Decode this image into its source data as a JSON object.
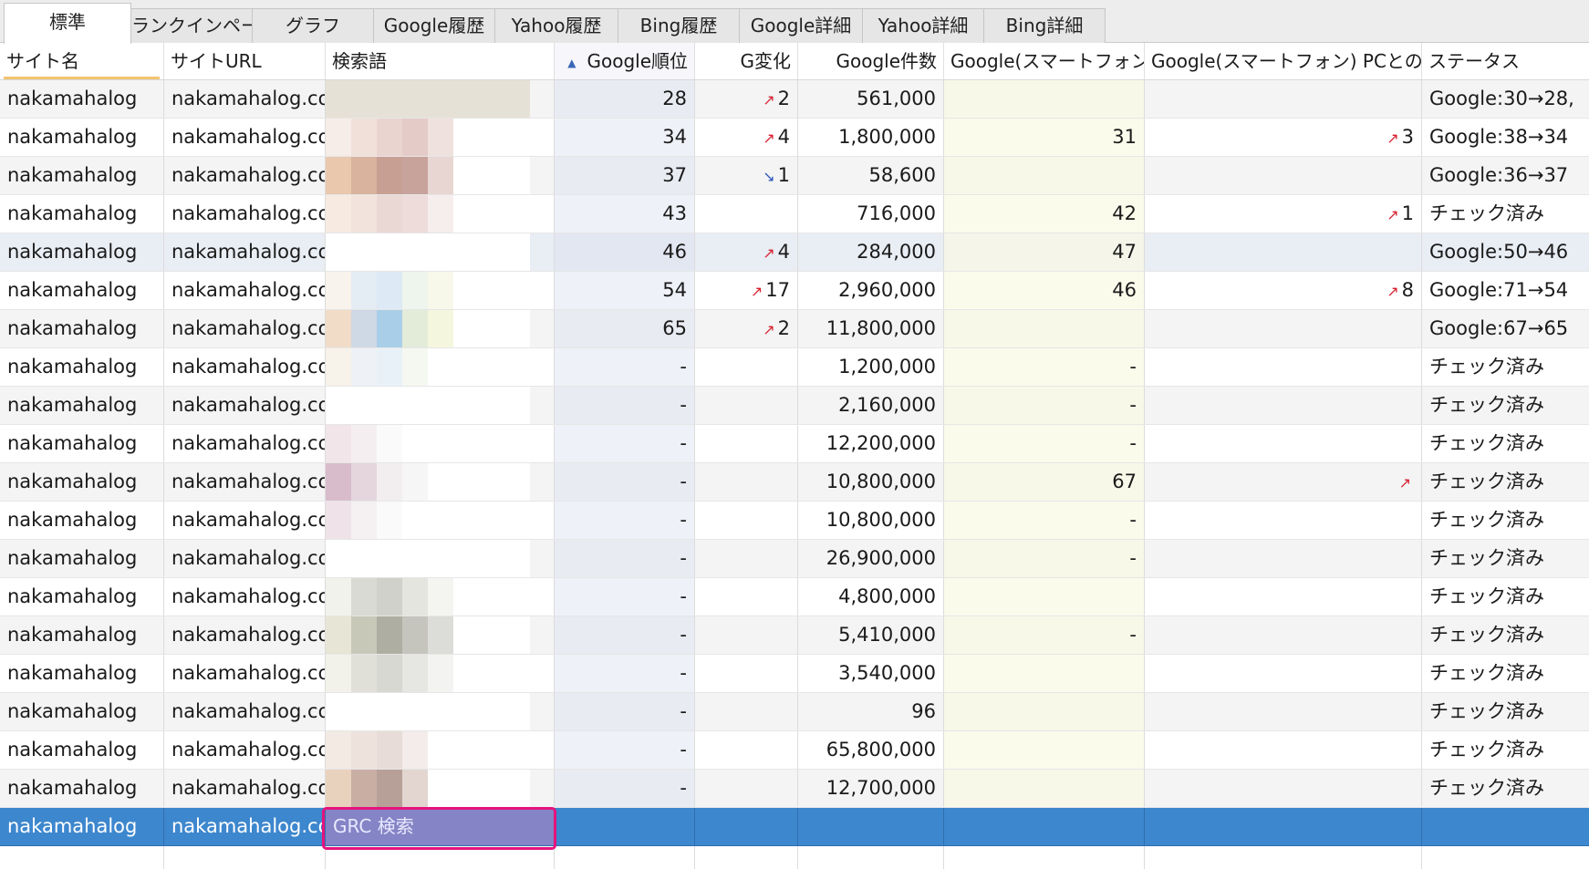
{
  "tabs": [
    "標準",
    "ランクインページ",
    "グラフ",
    "Google履歴",
    "Yahoo履歴",
    "Bing履歴",
    "Google詳細",
    "Yahoo詳細",
    "Bing詳細"
  ],
  "active_tab": 0,
  "columns": [
    "サイト名",
    "サイトURL",
    "検索語",
    "Google順位",
    "G変化",
    "Google件数",
    "Google(スマートフォン)",
    "Google(スマートフォン) PCとの差",
    "ステータス"
  ],
  "sorted_column": "Google順位",
  "sort_direction": "ascending",
  "colors": {
    "selection": "#3d87ce",
    "selected_keyword_bg": "#8484c6",
    "outline": "#e5137d",
    "arrow_up": "#d6202e",
    "arrow_down": "#2b56b8"
  },
  "rows": [
    {
      "site": "nakamahalog",
      "url": "nakamahalog.co",
      "keyword": "",
      "rank": "28",
      "change": "2",
      "change_dir": "up",
      "count": "561,000",
      "smart": "",
      "diff": "",
      "diff_dir": "",
      "status": "Google:30→28,"
    },
    {
      "site": "nakamahalog",
      "url": "nakamahalog.co",
      "keyword": "",
      "rank": "34",
      "change": "4",
      "change_dir": "up",
      "count": "1,800,000",
      "smart": "31",
      "diff": "3",
      "diff_dir": "up",
      "status": "Google:38→34"
    },
    {
      "site": "nakamahalog",
      "url": "nakamahalog.co",
      "keyword": "",
      "rank": "37",
      "change": "1",
      "change_dir": "down",
      "count": "58,600",
      "smart": "",
      "diff": "",
      "diff_dir": "",
      "status": "Google:36→37"
    },
    {
      "site": "nakamahalog",
      "url": "nakamahalog.co",
      "keyword": "",
      "rank": "43",
      "change": "",
      "change_dir": "",
      "count": "716,000",
      "smart": "42",
      "diff": "1",
      "diff_dir": "up",
      "status": "チェック済み"
    },
    {
      "site": "nakamahalog",
      "url": "nakamahalog.co",
      "keyword": "",
      "rank": "46",
      "change": "4",
      "change_dir": "up",
      "count": "284,000",
      "smart": "47",
      "diff": "",
      "diff_dir": "",
      "status": "Google:50→46"
    },
    {
      "site": "nakamahalog",
      "url": "nakamahalog.co",
      "keyword": "",
      "rank": "54",
      "change": "17",
      "change_dir": "up",
      "count": "2,960,000",
      "smart": "46",
      "diff": "8",
      "diff_dir": "up",
      "status": "Google:71→54"
    },
    {
      "site": "nakamahalog",
      "url": "nakamahalog.co",
      "keyword": "",
      "rank": "65",
      "change": "2",
      "change_dir": "up",
      "count": "11,800,000",
      "smart": "",
      "diff": "",
      "diff_dir": "",
      "status": "Google:67→65"
    },
    {
      "site": "nakamahalog",
      "url": "nakamahalog.co",
      "keyword": "",
      "rank": "-",
      "change": "",
      "change_dir": "",
      "count": "1,200,000",
      "smart": "-",
      "diff": "",
      "diff_dir": "",
      "status": "チェック済み"
    },
    {
      "site": "nakamahalog",
      "url": "nakamahalog.co",
      "keyword": "",
      "rank": "-",
      "change": "",
      "change_dir": "",
      "count": "2,160,000",
      "smart": "-",
      "diff": "",
      "diff_dir": "",
      "status": "チェック済み"
    },
    {
      "site": "nakamahalog",
      "url": "nakamahalog.co",
      "keyword": "",
      "rank": "-",
      "change": "",
      "change_dir": "",
      "count": "12,200,000",
      "smart": "-",
      "diff": "",
      "diff_dir": "",
      "status": "チェック済み"
    },
    {
      "site": "nakamahalog",
      "url": "nakamahalog.co",
      "keyword": "",
      "rank": "-",
      "change": "",
      "change_dir": "",
      "count": "10,800,000",
      "smart": "67",
      "diff": "",
      "diff_dir": "up",
      "status": "チェック済み"
    },
    {
      "site": "nakamahalog",
      "url": "nakamahalog.co",
      "keyword": "",
      "rank": "-",
      "change": "",
      "change_dir": "",
      "count": "10,800,000",
      "smart": "-",
      "diff": "",
      "diff_dir": "",
      "status": "チェック済み"
    },
    {
      "site": "nakamahalog",
      "url": "nakamahalog.co",
      "keyword": "",
      "rank": "-",
      "change": "",
      "change_dir": "",
      "count": "26,900,000",
      "smart": "-",
      "diff": "",
      "diff_dir": "",
      "status": "チェック済み"
    },
    {
      "site": "nakamahalog",
      "url": "nakamahalog.co",
      "keyword": "",
      "rank": "-",
      "change": "",
      "change_dir": "",
      "count": "4,800,000",
      "smart": "",
      "diff": "",
      "diff_dir": "",
      "status": "チェック済み"
    },
    {
      "site": "nakamahalog",
      "url": "nakamahalog.co",
      "keyword": "",
      "rank": "-",
      "change": "",
      "change_dir": "",
      "count": "5,410,000",
      "smart": "-",
      "diff": "",
      "diff_dir": "",
      "status": "チェック済み"
    },
    {
      "site": "nakamahalog",
      "url": "nakamahalog.co",
      "keyword": "",
      "rank": "-",
      "change": "",
      "change_dir": "",
      "count": "3,540,000",
      "smart": "",
      "diff": "",
      "diff_dir": "",
      "status": "チェック済み"
    },
    {
      "site": "nakamahalog",
      "url": "nakamahalog.co",
      "keyword": "",
      "rank": "-",
      "change": "",
      "change_dir": "",
      "count": "96",
      "smart": "",
      "diff": "",
      "diff_dir": "",
      "status": "チェック済み"
    },
    {
      "site": "nakamahalog",
      "url": "nakamahalog.co",
      "keyword": "",
      "rank": "-",
      "change": "",
      "change_dir": "",
      "count": "65,800,000",
      "smart": "",
      "diff": "",
      "diff_dir": "",
      "status": "チェック済み"
    },
    {
      "site": "nakamahalog",
      "url": "nakamahalog.co",
      "keyword": "",
      "rank": "-",
      "change": "",
      "change_dir": "",
      "count": "12,700,000",
      "smart": "",
      "diff": "",
      "diff_dir": "",
      "status": "チェック済み"
    },
    {
      "site": "nakamahalog",
      "url": "nakamahalog.co",
      "keyword": "GRC 検索",
      "rank": "",
      "change": "",
      "change_dir": "",
      "count": "",
      "smart": "",
      "diff": "",
      "diff_dir": "",
      "status": "",
      "selected": true
    }
  ]
}
